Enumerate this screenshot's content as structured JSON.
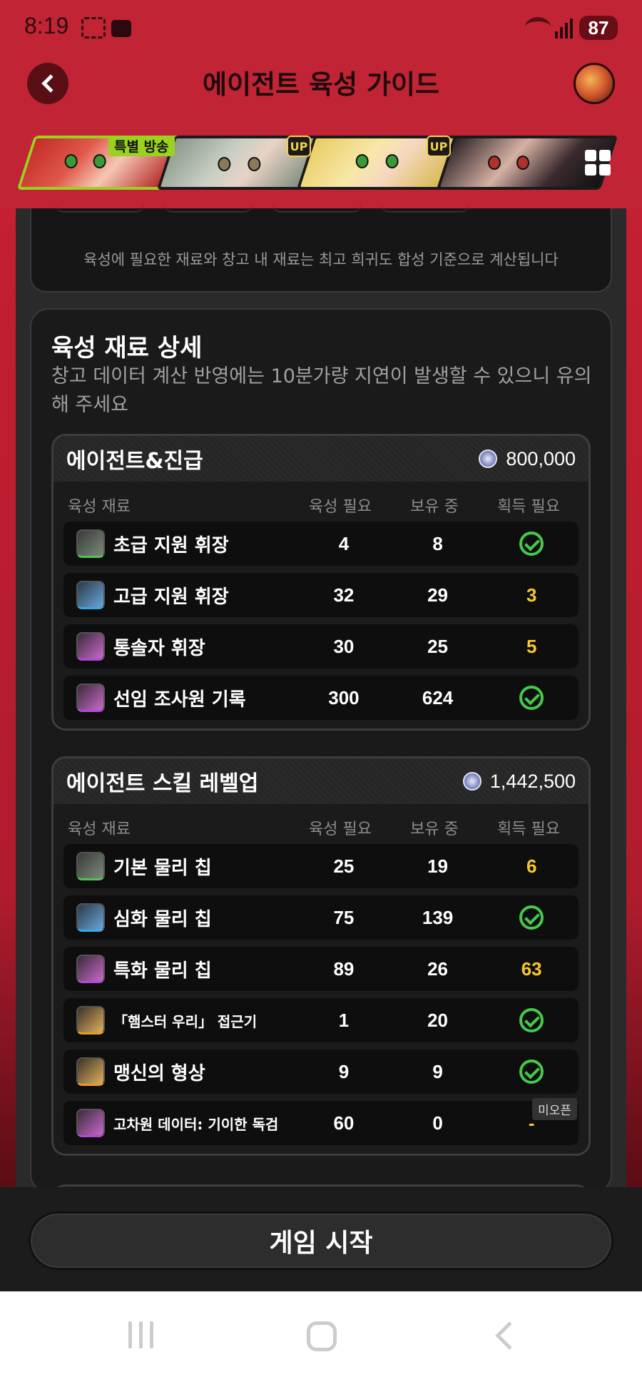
{
  "status_bar": {
    "time": "8:19",
    "battery": "87"
  },
  "header": {
    "title": "에이전트 육성 가이드"
  },
  "agents": {
    "badge_special": "특별 방송",
    "badge_up": "UP"
  },
  "notice": "육성에 필요한 재료와 창고 내 재료는 최고 희귀도 합성 기준으로 계산됩니다",
  "detail": {
    "title": "육성 재료 상세",
    "description": "창고 데이터 계산 반영에는 10분가량 지연이 발생할 수 있으니 유의해 주세요"
  },
  "columns": {
    "material": "육성 재료",
    "required": "육성 필요",
    "owned": "보유 중",
    "needed": "획득 필요"
  },
  "sections": [
    {
      "title": "에이전트&진급",
      "cost": "800,000",
      "rows": [
        {
          "name": "초급 지원 휘장",
          "required": "4",
          "owned": "8",
          "needed": "",
          "done": true
        },
        {
          "name": "고급 지원 휘장",
          "required": "32",
          "owned": "29",
          "needed": "3",
          "done": false
        },
        {
          "name": "통솔자 휘장",
          "required": "30",
          "owned": "25",
          "needed": "5",
          "done": false
        },
        {
          "name": "선임 조사원 기록",
          "required": "300",
          "owned": "624",
          "needed": "",
          "done": true
        }
      ]
    },
    {
      "title": "에이전트 스킬 레벨업",
      "cost": "1,442,500",
      "rows": [
        {
          "name": "기본 물리 칩",
          "required": "25",
          "owned": "19",
          "needed": "6",
          "done": false
        },
        {
          "name": "심화 물리 칩",
          "required": "75",
          "owned": "139",
          "needed": "",
          "done": true
        },
        {
          "name": "특화 물리 칩",
          "required": "89",
          "owned": "26",
          "needed": "63",
          "done": false
        },
        {
          "name": "「햄스터 우리」 접근기",
          "required": "1",
          "owned": "20",
          "needed": "",
          "done": true
        },
        {
          "name": "맹신의 형상",
          "required": "9",
          "owned": "9",
          "needed": "",
          "done": true
        },
        {
          "name": "고차원 데이터: 기이한 독검",
          "required": "60",
          "owned": "0",
          "needed": "-",
          "done": false,
          "tag": "미오픈"
        }
      ]
    }
  ],
  "start_button": "게임 시작",
  "colors": {
    "accent_red": "#c12434",
    "check_green": "#46c94a",
    "need_yellow": "#f7c62f"
  }
}
